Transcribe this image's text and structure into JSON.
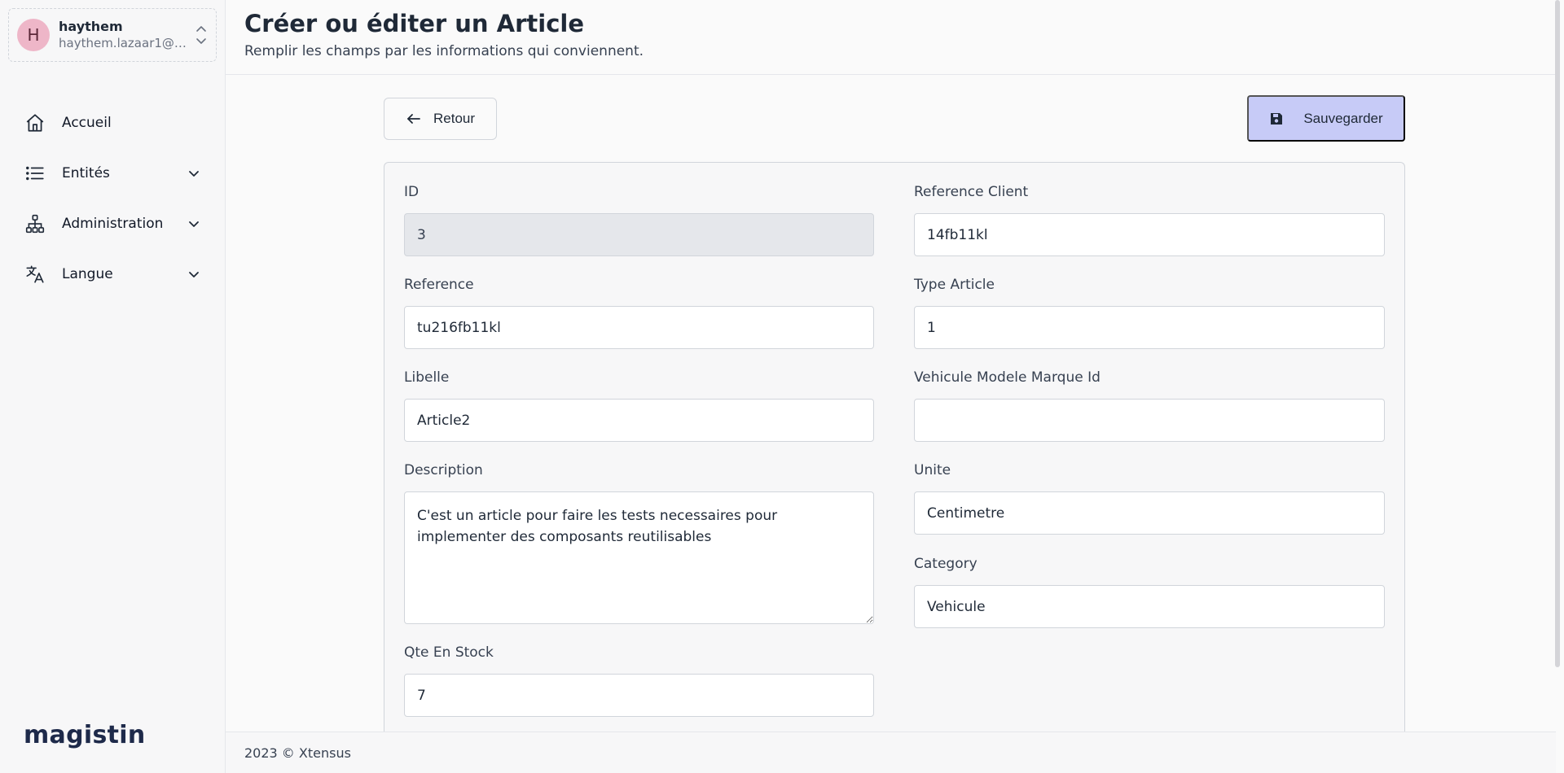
{
  "user": {
    "initial": "H",
    "name": "haythem",
    "email": "haythem.lazaar1@gm..."
  },
  "nav": {
    "items": [
      {
        "label": "Accueil",
        "icon": "home-icon"
      },
      {
        "label": "Entités",
        "icon": "list-icon"
      },
      {
        "label": "Administration",
        "icon": "hierarchy-icon"
      },
      {
        "label": "Langue",
        "icon": "translate-icon"
      }
    ]
  },
  "brand": "magistin",
  "header": {
    "title": "Créer ou éditer un Article",
    "subtitle": "Remplir les champs par les informations qui conviennent."
  },
  "actions": {
    "back_label": "Retour",
    "save_label": "Sauvegarder"
  },
  "form": {
    "id": {
      "label": "ID",
      "value": "3"
    },
    "reference_client": {
      "label": "Reference Client",
      "value": "14fb11kl"
    },
    "reference": {
      "label": "Reference",
      "value": "tu216fb11kl"
    },
    "type_article": {
      "label": "Type Article",
      "value": "1"
    },
    "libelle": {
      "label": "Libelle",
      "value": "Article2"
    },
    "vehicule_modele_marque_id": {
      "label": "Vehicule Modele Marque Id",
      "value": ""
    },
    "description": {
      "label": "Description",
      "value": "C'est un article pour faire les tests necessaires pour implementer des composants reutilisables"
    },
    "unite": {
      "label": "Unite",
      "value": "Centimetre"
    },
    "category": {
      "label": "Category",
      "value": "Vehicule"
    },
    "qte_en_stock": {
      "label": "Qte En Stock",
      "value": "7"
    }
  },
  "footer": {
    "text": "2023 © Xtensus"
  },
  "colors": {
    "save_button_bg": "#c7cbf7",
    "avatar_bg": "#eeb6c8",
    "readonly_input_bg": "#e5e7eb"
  }
}
